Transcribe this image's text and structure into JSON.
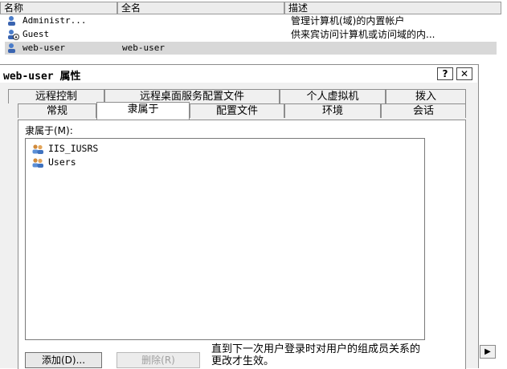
{
  "userlist": {
    "columns": [
      "名称",
      "全名",
      "描述"
    ],
    "rows": [
      {
        "name": "Administr...",
        "fullname": "",
        "desc": "管理计算机(域)的内置帐户"
      },
      {
        "name": "Guest",
        "fullname": "",
        "desc": "供来宾访问计算机或访问域的内..."
      },
      {
        "name": "web-user",
        "fullname": "web-user",
        "desc": ""
      }
    ]
  },
  "dialog": {
    "title": "web-user 属性",
    "help_label": "?",
    "close_label": "✕",
    "tabs_row1": [
      "远程控制",
      "远程桌面服务配置文件",
      "个人虚拟机",
      "拨入"
    ],
    "tabs_row2": [
      "常规",
      "隶属于",
      "配置文件",
      "环境",
      "会话"
    ],
    "active_tab": "隶属于",
    "member_label": "隶属于(M):",
    "groups": [
      "IIS_IUSRS",
      "Users"
    ],
    "add_button": "添加(D)...",
    "remove_button": "删除(R)",
    "note": "直到下一次用户登录时对用户的组成员关系的更改才生效。"
  },
  "scroll_down_icon": "▶"
}
